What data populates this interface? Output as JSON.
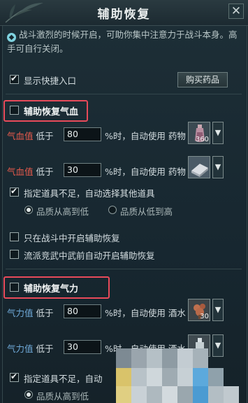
{
  "window": {
    "title": "辅助恢复"
  },
  "notice": {
    "text": "战斗激烈的时候开启，可助你集中注意力于战斗本身。高手可自行关闭。"
  },
  "quick_entry": {
    "label": "显示快捷入口",
    "checked": true
  },
  "buy_button": {
    "label": "购买药品"
  },
  "hp_section": {
    "title": "辅助恢复气血",
    "checked": false,
    "rows": [
      {
        "stat": "气血值",
        "below": "低于",
        "value": "80",
        "suffix": "%时，自动使用",
        "item_type": "药物",
        "item_count": "360"
      },
      {
        "stat": "气血值",
        "below": "低于",
        "value": "30",
        "suffix": "%时，自动使用",
        "item_type": "药物",
        "item_count": ""
      }
    ],
    "fallback": {
      "label": "指定道具不足，自动选择其他道具",
      "checked": true
    },
    "order_high": "品质从高到低",
    "order_low": "品质从低到高",
    "combat_only": "只在战斗中开启辅助恢复",
    "school_pvp": "流派竞武中武前自动开启辅助恢复"
  },
  "mp_section": {
    "title": "辅助恢复气力",
    "checked": false,
    "rows": [
      {
        "stat": "气力值",
        "below": "低于",
        "value": "80",
        "suffix": "%时，自动使用",
        "item_type": "酒水",
        "item_count": "30"
      },
      {
        "stat": "气力值",
        "below": "低于",
        "value": "30",
        "suffix": "%时，自动使用",
        "item_type": "酒水",
        "item_count": ""
      }
    ],
    "fallback": {
      "label": "指定道具不足，自动",
      "checked": true
    },
    "order_high": "品质从高到低"
  },
  "colors": {
    "accent_red": "#e84a5a",
    "hp_stat": "#e65a4c",
    "mp_stat": "#6fa9d8"
  }
}
